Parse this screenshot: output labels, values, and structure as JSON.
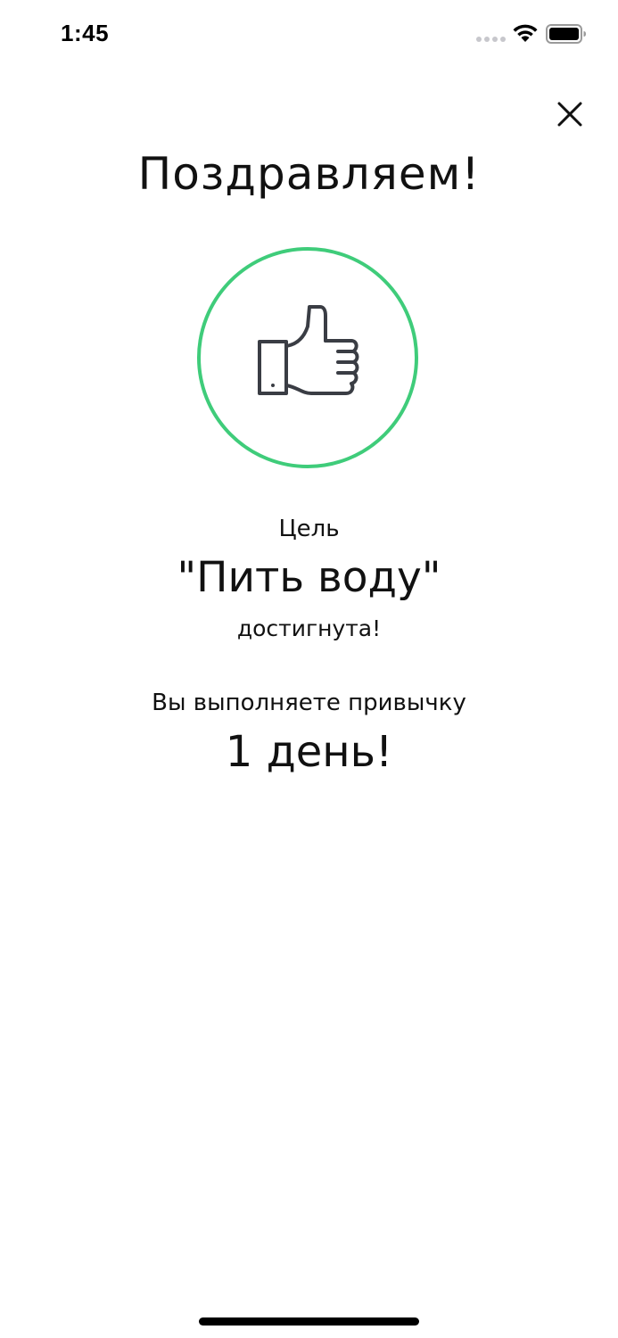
{
  "status_bar": {
    "time": "1:45",
    "icons": [
      "signal-dots-icon",
      "wifi-icon",
      "battery-icon"
    ]
  },
  "header": {
    "close_icon": "close-icon"
  },
  "title": "Поздравляем!",
  "badge": {
    "icon": "thumbs-up-icon",
    "ring_color": "#3fcc7a"
  },
  "goal": {
    "caption": "Цель",
    "name": "\"Пить воду\"",
    "status": "достигнута!"
  },
  "streak": {
    "caption": "Вы выполняете привычку",
    "value": "1 день!"
  },
  "colors": {
    "accent": "#3fcc7a",
    "text": "#111111",
    "icon": "#3a3d44"
  }
}
